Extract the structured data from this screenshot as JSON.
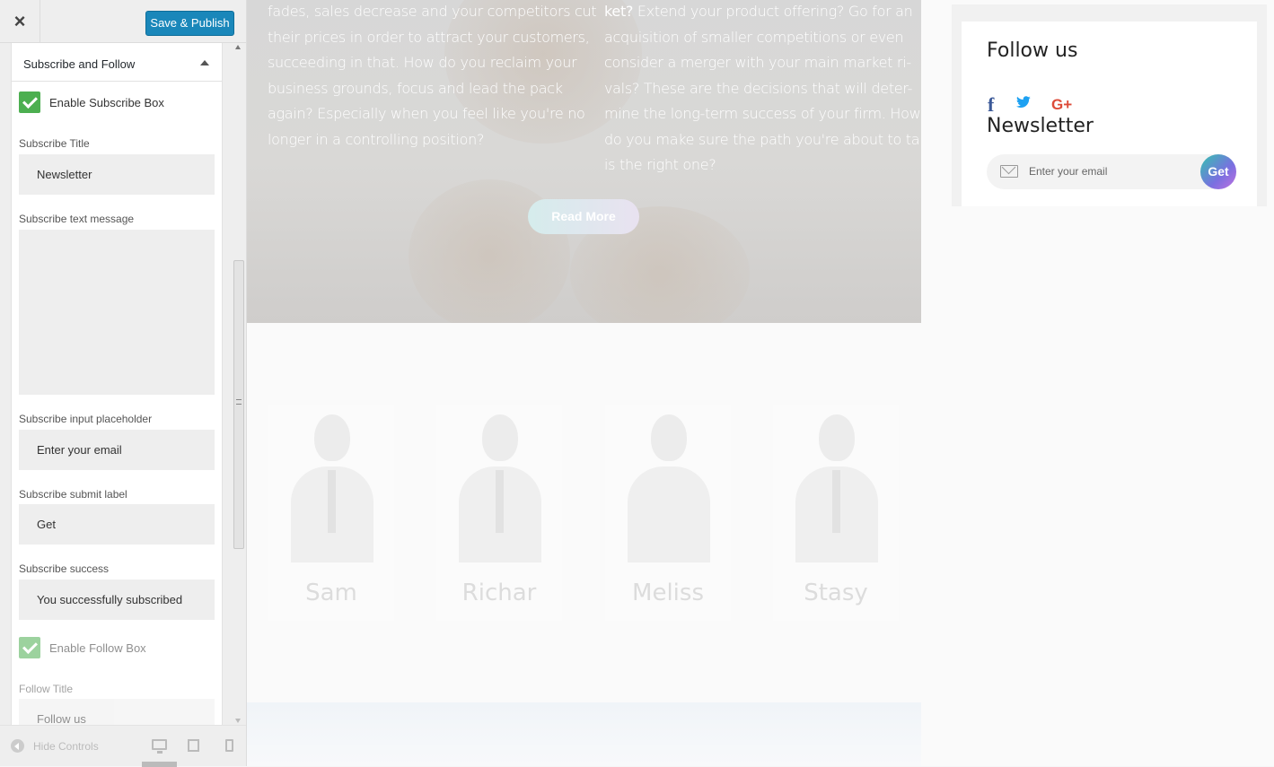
{
  "header": {
    "close_label": "×",
    "save_label": "Save & Publish"
  },
  "section": {
    "title": "Subscribe and Follow"
  },
  "fields": {
    "enable_subscribe_label": "Enable Subscribe Box",
    "subscribe_title_label": "Subscribe Title",
    "subscribe_title_value": "Newsletter",
    "subscribe_text_label": "Subscribe text message",
    "subscribe_text_value": "",
    "placeholder_label": "Subscribe input placeholder",
    "placeholder_value": "Enter your email",
    "submit_label": "Subscribe submit label",
    "submit_value": "Get",
    "success_label": "Subscribe success",
    "success_value": "You successfully subscribed",
    "enable_follow_label": "Enable Follow Box",
    "follow_title_label": "Follow Title",
    "follow_title_value": "Follow us"
  },
  "footer": {
    "hide_controls": "Hide Controls"
  },
  "hero": {
    "col1_lines": [
      "fades, sales decrease and your competitors cut",
      "their prices in order to attract your customers,",
      "succeeding in that. How do you reclaim your",
      "business grounds, focus and lead the pack",
      "again? Especially when you feel like you're no",
      "longer in a controlling position?"
    ],
    "col2_bold": "ket?",
    "col2_first_rest": " Extend your product offering? Go for an",
    "col2_lines": [
      "acquisition of smaller competitions or even",
      "consider a merger with your main market ri-",
      "vals? These are the decisions that will deter-",
      "mine the long-term success of your firm. How",
      "do you make sure the path you're about to take",
      "is the right one?"
    ],
    "read_more": "Read More"
  },
  "team": [
    {
      "name": "Sam"
    },
    {
      "name": "Richar"
    },
    {
      "name": "Meliss"
    },
    {
      "name": "Stasy"
    }
  ],
  "widget": {
    "follow_title": "Follow us",
    "facebook_glyph": "f",
    "gplus_glyph": "G+",
    "newsletter_title": "Newsletter",
    "email_placeholder": "Enter your email",
    "get_label": "Get"
  },
  "icons": {
    "close": "close-icon",
    "collapse": "triangle-up-icon",
    "checkbox": "checkmark-icon",
    "hide": "arrow-left-circle-icon",
    "desktop": "desktop-icon",
    "tablet": "tablet-icon",
    "mobile": "mobile-icon",
    "facebook": "facebook-icon",
    "twitter": "twitter-icon",
    "gplus": "google-plus-icon",
    "mail": "envelope-icon"
  },
  "colors": {
    "primary_button": "#1a87ba",
    "checkbox": "#4caf50",
    "facebook": "#3b5998",
    "twitter": "#1da1f2",
    "gplus": "#dd4b39"
  }
}
